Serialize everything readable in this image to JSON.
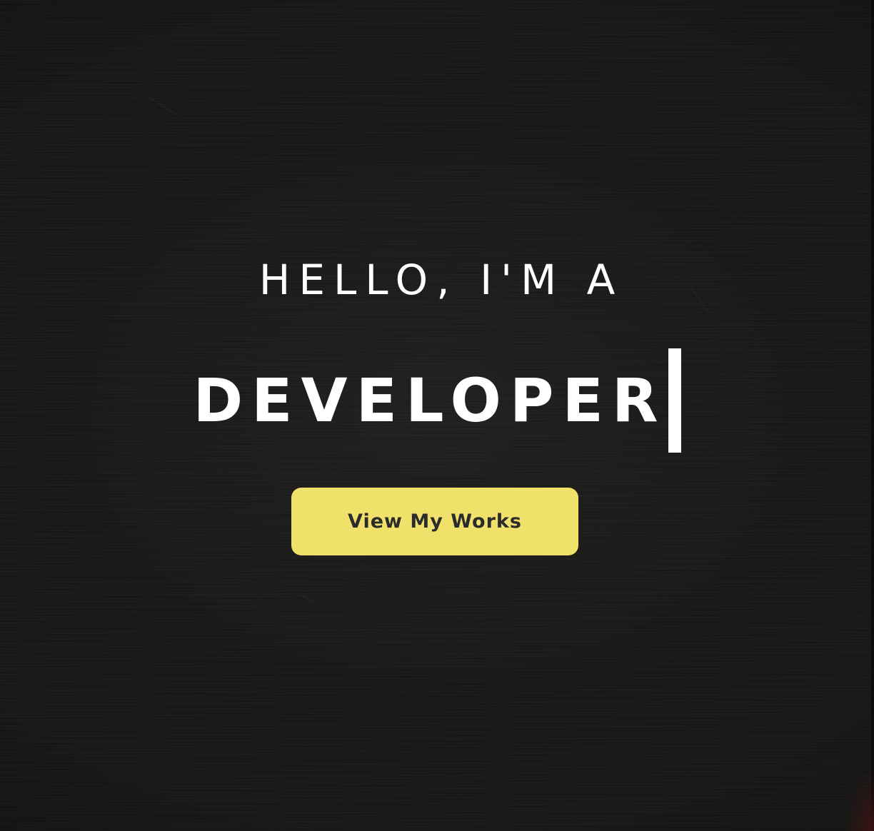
{
  "hero": {
    "greeting": "HELLO, I'M A",
    "role": "DEVELOPER",
    "cta_label": "View My Works"
  },
  "colors": {
    "background": "#1a1918",
    "text": "#ffffff",
    "accent": "#f0e16b",
    "button_text": "#2b2b2b"
  }
}
